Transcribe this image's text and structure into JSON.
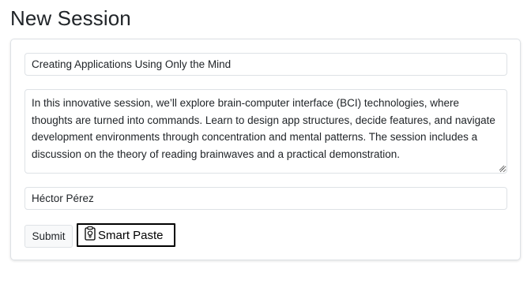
{
  "page": {
    "title": "New Session"
  },
  "form": {
    "session_title": "Creating Applications Using Only the Mind",
    "description": "In this innovative session, we’ll explore brain-computer interface (BCI) technologies, where thoughts are turned into commands. Learn to design app structures, decide features, and navigate development environments through concentration and mental patterns. The session includes a discussion on the theory of reading brainwaves and a practical demonstration.",
    "speaker": "Héctor Pérez"
  },
  "actions": {
    "submit_label": "Submit",
    "smart_paste_label": "Smart Paste",
    "smart_paste_icon": "clipboard-lightbulb-icon"
  }
}
